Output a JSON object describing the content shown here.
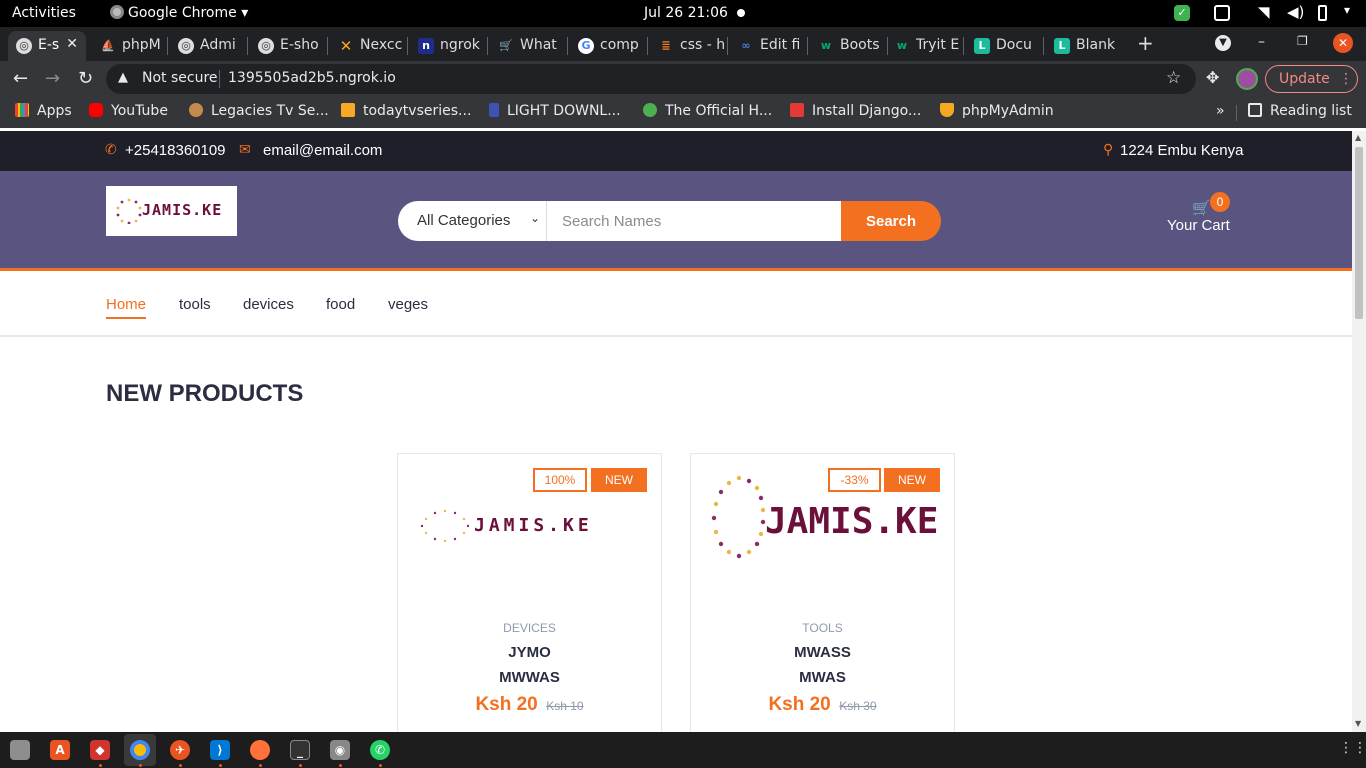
{
  "system": {
    "activities": "Activities",
    "app_name": "Google Chrome",
    "clock": "Jul 26  21:06"
  },
  "tabs": [
    {
      "label": "E-s",
      "active": true
    },
    {
      "label": "phpM"
    },
    {
      "label": "Admi"
    },
    {
      "label": "E-sho"
    },
    {
      "label": "Nexcc"
    },
    {
      "label": "ngrok"
    },
    {
      "label": "What"
    },
    {
      "label": "comp"
    },
    {
      "label": "css - h"
    },
    {
      "label": "Edit fi"
    },
    {
      "label": "Boots"
    },
    {
      "label": "Tryit E"
    },
    {
      "label": "Docu"
    },
    {
      "label": "Blank"
    }
  ],
  "browser": {
    "security": "Not secure",
    "url": "1395505ad2b5.ngrok.io",
    "update_label": "Update"
  },
  "bookmarks": [
    {
      "label": "Apps",
      "icon": "apps-grid-icon",
      "color": "#ea4335"
    },
    {
      "label": "YouTube",
      "icon": "youtube-icon",
      "color": "#ff0000"
    },
    {
      "label": "Legacies Tv Se...",
      "icon": "person-icon",
      "color": "#c58b4c"
    },
    {
      "label": "todaytvseries...",
      "icon": "chart-icon",
      "color": "#f9a825"
    },
    {
      "label": "LIGHT DOWNL...",
      "icon": "download-icon",
      "color": "#3f51b5"
    },
    {
      "label": "The Official H...",
      "icon": "leaf-icon",
      "color": "#4caf50"
    },
    {
      "label": "Install Django...",
      "icon": "os-icon",
      "color": "#e53935"
    },
    {
      "label": "phpMyAdmin",
      "icon": "phpmyadmin-icon",
      "color": "#f5a623"
    }
  ],
  "reading_list": "Reading list",
  "site": {
    "phone": "+25418360109",
    "email": "email@email.com",
    "location": "1224 Embu Kenya",
    "logo_text": "JAMIS.KE",
    "category_select": "All Categories",
    "search_placeholder": "Search Names",
    "search_button": "Search",
    "cart_count": "0",
    "cart_label": "Your Cart",
    "nav": [
      "Home",
      "tools",
      "devices",
      "food",
      "veges"
    ],
    "section_title": "NEW PRODUCTS",
    "colors": {
      "accent": "#f37021",
      "header": "#595480",
      "topbar": "#1e1f29",
      "logo": "#6b0f3b"
    }
  },
  "products": [
    {
      "sale_badge": "100%",
      "new_badge": "NEW",
      "image_text": "JAMIS.KE",
      "category": "DEVICES",
      "name_line1": "JYMO",
      "name_line2": "MWWAS",
      "price": "Ksh 20",
      "old_price": "Ksh 10"
    },
    {
      "sale_badge": "-33%",
      "new_badge": "NEW",
      "image_text": "JAMIS.KE",
      "category": "TOOLS",
      "name_line1": "MWASS",
      "name_line2": "MWAS",
      "price": "Ksh 20",
      "old_price": "Ksh 30"
    }
  ]
}
